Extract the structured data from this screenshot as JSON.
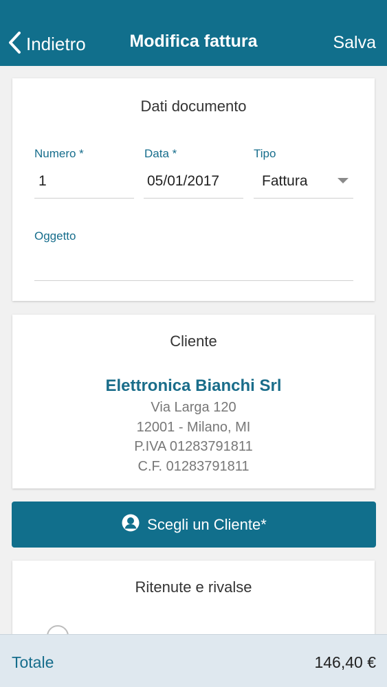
{
  "navbar": {
    "back_label": "Indietro",
    "title": "Modifica fattura",
    "save_label": "Salva",
    "background": "#116f8c"
  },
  "document": {
    "title": "Dati documento",
    "numero": {
      "label": "Numero *",
      "value": "1"
    },
    "data": {
      "label": "Data *",
      "value": "05/01/2017"
    },
    "tipo": {
      "label": "Tipo",
      "value": "Fattura"
    },
    "oggetto": {
      "label": "Oggetto",
      "value": ""
    }
  },
  "client": {
    "title": "Cliente",
    "name": "Elettronica Bianchi Srl",
    "address": "Via Larga 120",
    "city": "12001 - Milano, MI",
    "piva": "P.IVA 01283791811",
    "cf": "C.F. 01283791811"
  },
  "choose_client": {
    "label": "Scegli un Cliente*",
    "icon": "user-circle-icon"
  },
  "withholdings": {
    "title": "Ritenute e rivalse"
  },
  "footer": {
    "total_label": "Totale",
    "total_value": "146,40 €"
  },
  "colors": {
    "accent": "#116f8c",
    "label": "#166d8c",
    "footer_bg": "#dfe8ef"
  }
}
